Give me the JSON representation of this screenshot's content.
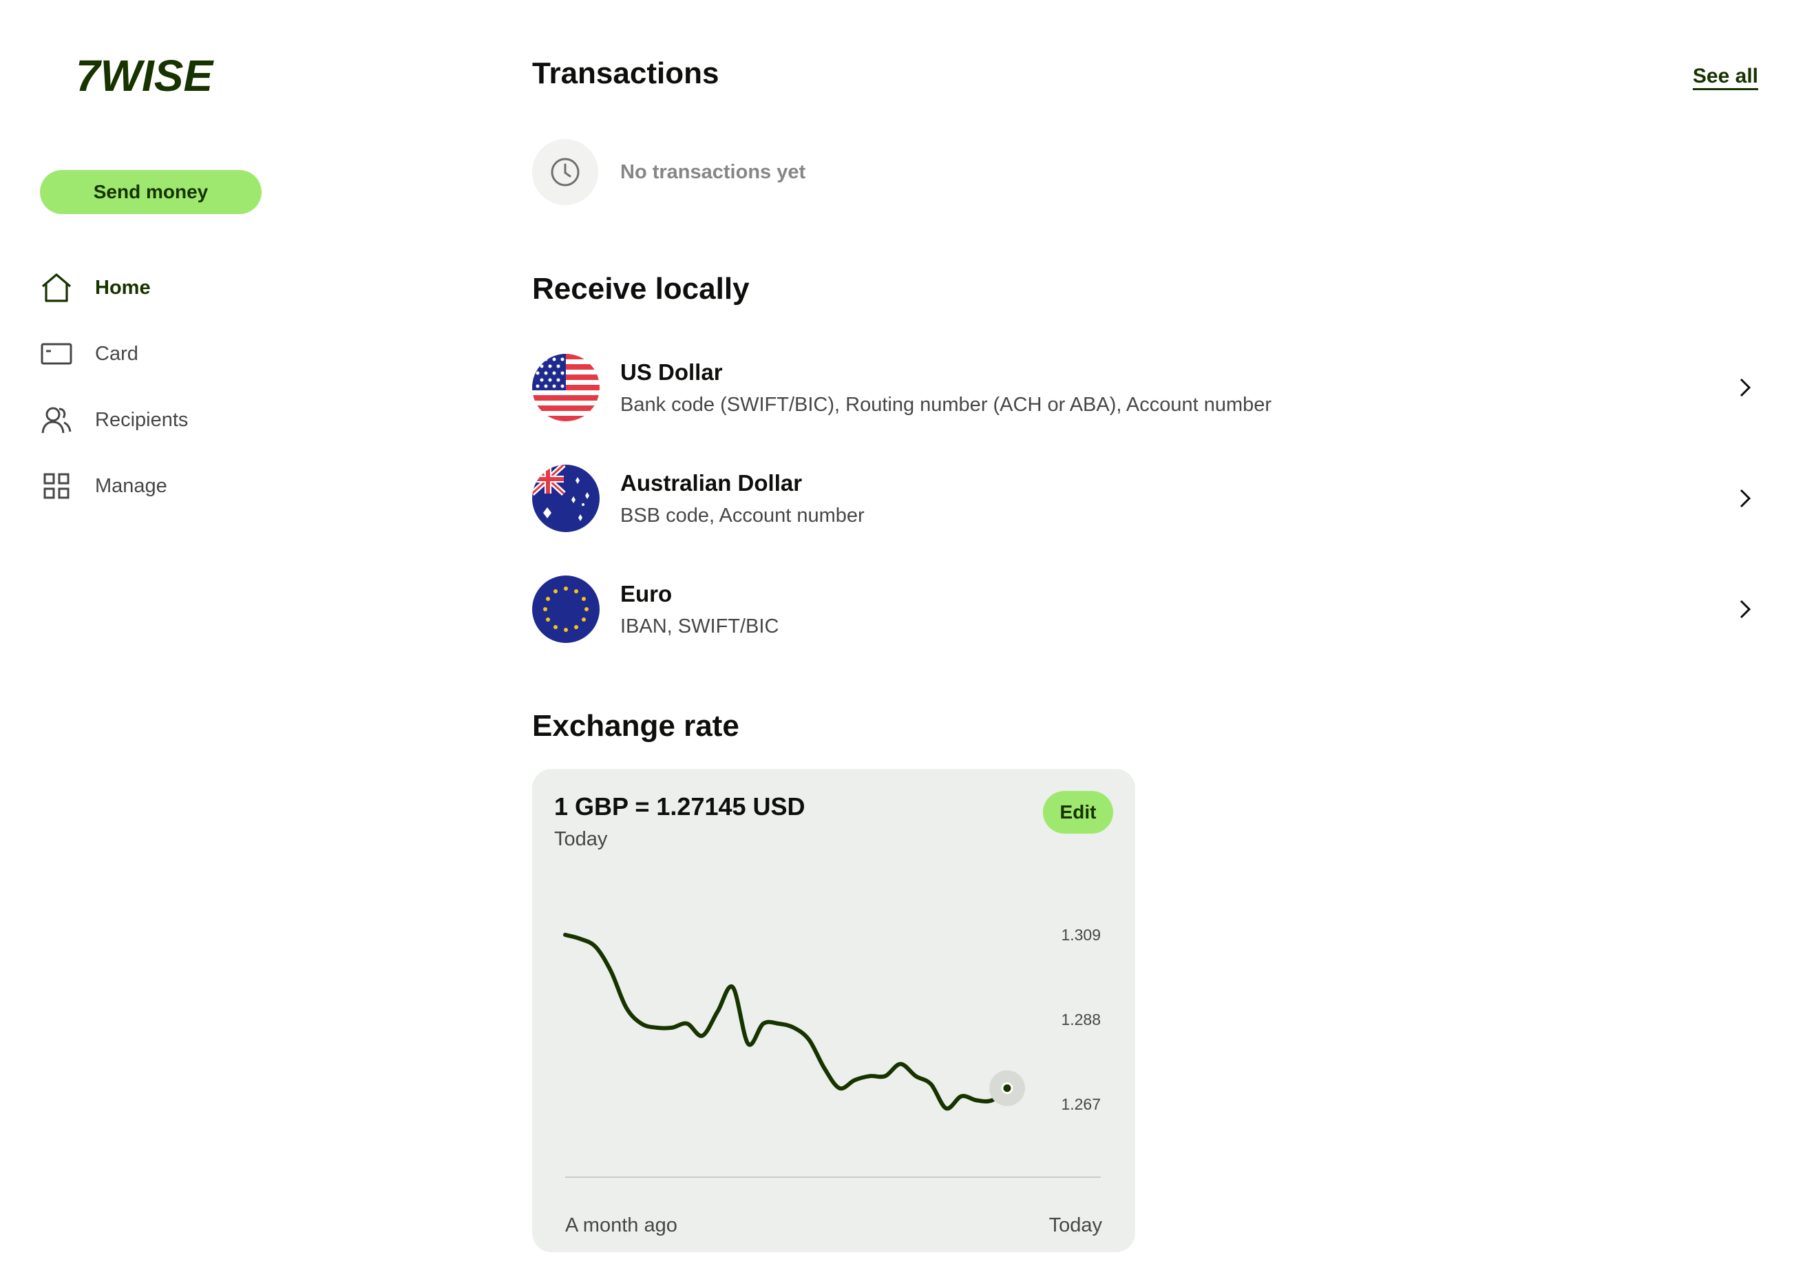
{
  "brand": {
    "logo_text": "7WISE",
    "accent": "#9fe870",
    "dark": "#163300"
  },
  "sidebar": {
    "send_money": "Send money",
    "items": [
      {
        "label": "Home",
        "icon": "home-icon",
        "active": true
      },
      {
        "label": "Card",
        "icon": "card-icon",
        "active": false
      },
      {
        "label": "Recipients",
        "icon": "recipients-icon",
        "active": false
      },
      {
        "label": "Manage",
        "icon": "grid-icon",
        "active": false
      }
    ]
  },
  "transactions": {
    "title": "Transactions",
    "see_all": "See all",
    "empty_text": "No transactions yet",
    "empty_icon": "clock-icon"
  },
  "receive": {
    "title": "Receive locally",
    "currencies": [
      {
        "name": "US Dollar",
        "details": "Bank code (SWIFT/BIC), Routing number (ACH or ABA), Account number",
        "flag": "us-flag-icon"
      },
      {
        "name": "Australian Dollar",
        "details": "BSB code, Account number",
        "flag": "au-flag-icon"
      },
      {
        "name": "Euro",
        "details": "IBAN, SWIFT/BIC",
        "flag": "eu-flag-icon"
      }
    ]
  },
  "exchange": {
    "title": "Exchange rate",
    "rate": "1 GBP = 1.27145 USD",
    "date": "Today",
    "edit": "Edit",
    "x_start": "A month ago",
    "x_end": "Today"
  },
  "chart_data": {
    "type": "line",
    "title": "",
    "xlabel": "",
    "ylabel": "",
    "y_ticks": [
      "1.309",
      "1.288",
      "1.267"
    ],
    "ylim": [
      1.258,
      1.316
    ],
    "x_range": [
      "A month ago",
      "Today"
    ],
    "series": [
      {
        "values": [
          1.309,
          1.308,
          1.306,
          1.3,
          1.291,
          1.287,
          1.286,
          1.286,
          1.287,
          1.284,
          1.29,
          1.296,
          1.282,
          1.287,
          1.287,
          1.286,
          1.283,
          1.276,
          1.271,
          1.273,
          1.274,
          1.274,
          1.277,
          1.274,
          1.272,
          1.266,
          1.269,
          1.268,
          1.268,
          1.271
        ]
      }
    ],
    "line_color": "#163300",
    "grid": false
  }
}
